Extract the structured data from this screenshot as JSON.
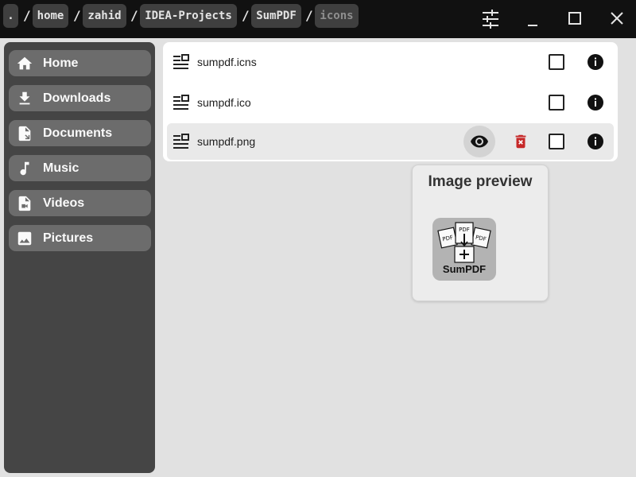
{
  "breadcrumb": [
    {
      "label": "."
    },
    {
      "label": "home"
    },
    {
      "label": "zahid"
    },
    {
      "label": "IDEA-Projects"
    },
    {
      "label": "SumPDF"
    },
    {
      "label": "icons"
    }
  ],
  "breadcrumb_separator": "/",
  "window_controls": {
    "settings": "sliders-icon",
    "minimize": "minimize-icon",
    "maximize": "maximize-icon",
    "close": "close-icon"
  },
  "sidebar": {
    "items": [
      {
        "label": "Home",
        "icon": "home-icon"
      },
      {
        "label": "Downloads",
        "icon": "download-icon"
      },
      {
        "label": "Documents",
        "icon": "document-icon"
      },
      {
        "label": "Music",
        "icon": "music-icon"
      },
      {
        "label": "Videos",
        "icon": "video-file-icon"
      },
      {
        "label": "Pictures",
        "icon": "image-icon"
      }
    ]
  },
  "files": [
    {
      "name": "sumpdf.icns",
      "checked": false
    },
    {
      "name": "sumpdf.ico",
      "checked": false
    },
    {
      "name": "sumpdf.png",
      "checked": false,
      "hovered": true
    }
  ],
  "preview": {
    "title": "Image preview",
    "logo_text": "SumPDF",
    "logo_doc_label": "PDF"
  },
  "colors": {
    "topbar": "#111111",
    "sidebar": "#454545",
    "sidebar_item": "#6c6c6c",
    "delete_red": "#c62828",
    "background": "#e1e1e1"
  }
}
